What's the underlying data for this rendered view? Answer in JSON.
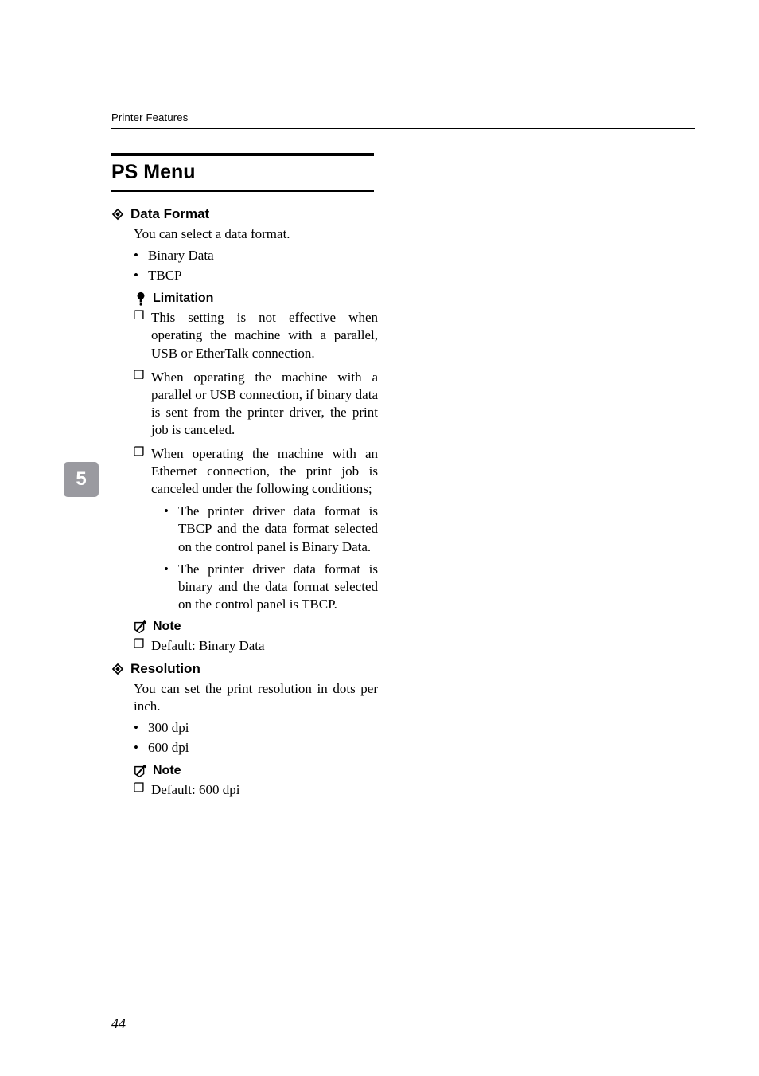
{
  "header": "Printer Features",
  "chapter_tab": "5",
  "section_title": "PS Menu",
  "page_number": "44",
  "data_format": {
    "heading": "Data Format",
    "intro": "You can select a data format.",
    "bullets": [
      "Binary Data",
      "TBCP"
    ],
    "limitation_label": "Limitation",
    "limitation_items": [
      "This setting is not effective when operating the machine with a parallel, USB or EtherTalk connection.",
      "When operating the machine with a parallel or USB connection, if binary data is sent from the printer driver, the print job is canceled.",
      "When operating the machine with an Ethernet connection, the print job is canceled under the following conditions;"
    ],
    "sub_conditions": [
      "The printer driver data format is TBCP and the data format selected on the control panel is Binary Data.",
      "The printer driver data format is binary and the data format selected on the control panel is TBCP."
    ],
    "note_label": "Note",
    "note_items": [
      "Default: Binary Data"
    ]
  },
  "resolution": {
    "heading": "Resolution",
    "intro": "You can set the print resolution in dots per inch.",
    "bullets": [
      "300 dpi",
      "600 dpi"
    ],
    "note_label": "Note",
    "note_items": [
      "Default: 600 dpi"
    ]
  }
}
